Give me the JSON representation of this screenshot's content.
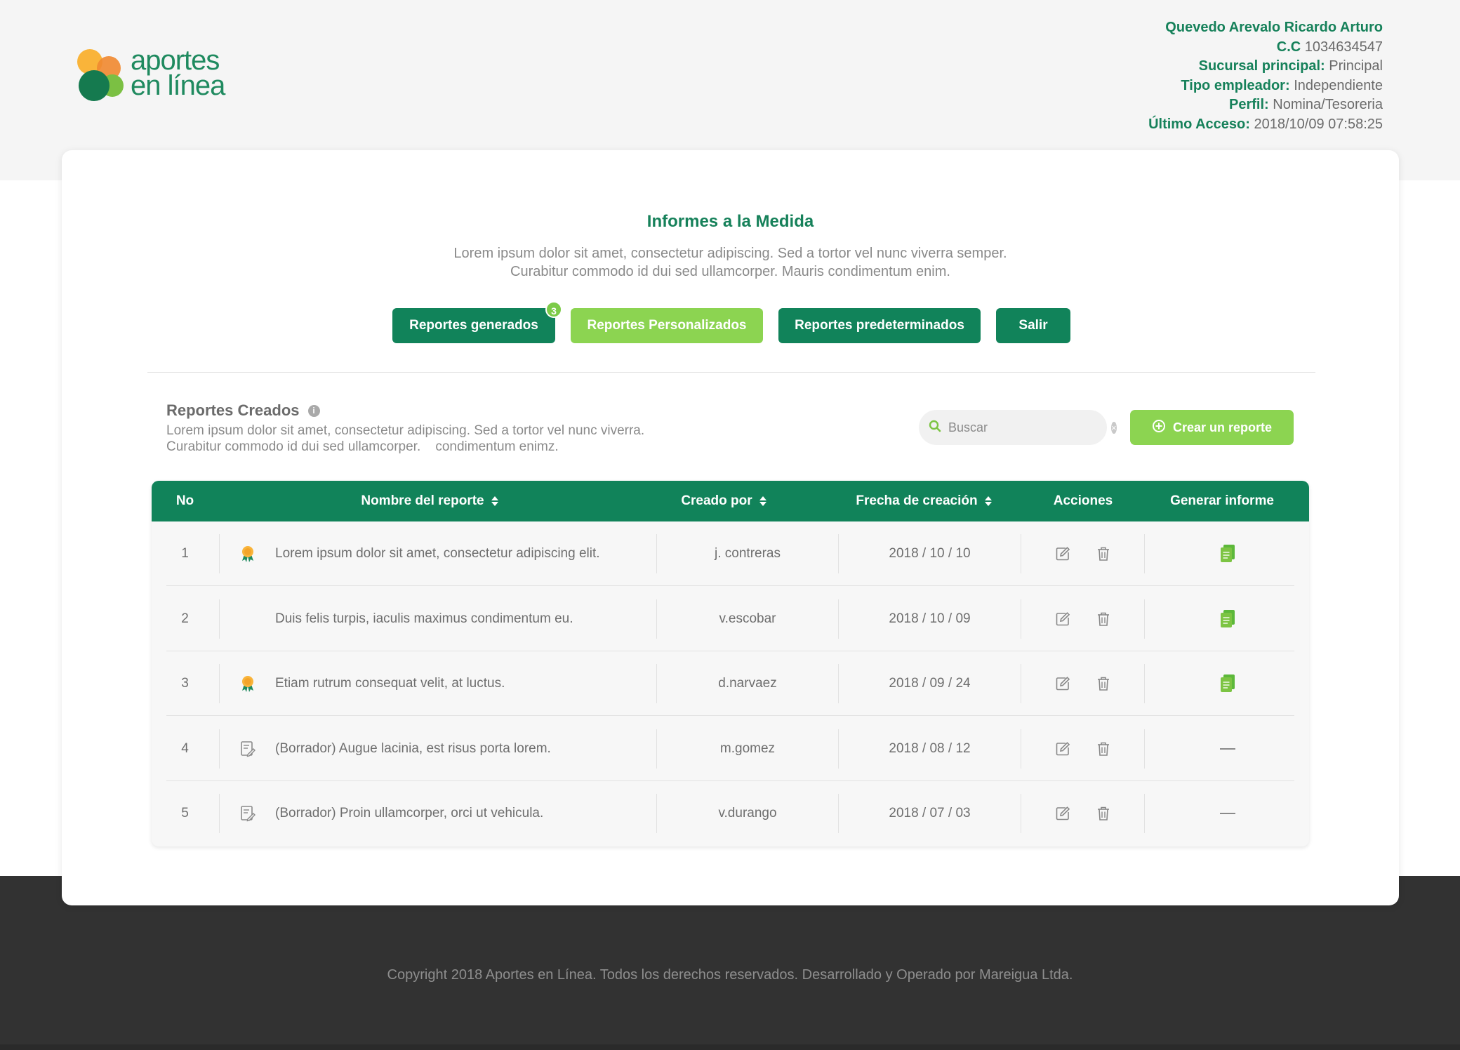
{
  "app": {
    "logo_line1": "aportes",
    "logo_line2": "en línea"
  },
  "user": {
    "name": "Quevedo Arevalo Ricardo Arturo",
    "cc_label": "C.C",
    "cc_value": "1034634547",
    "branch_label": "Sucursal principal:",
    "branch_value": "Principal",
    "employer_label": "Tipo empleador:",
    "employer_value": "Independiente",
    "profile_label": "Perfil:",
    "profile_value": "Nomina/Tesoreria",
    "last_access_label": "Último Acceso:",
    "last_access_value": "2018/10/09 07:58:25"
  },
  "page": {
    "title": "Informes a la Medida",
    "desc_line1": "Lorem ipsum dolor sit amet, consectetur adipiscing. Sed a tortor vel nunc viverra semper.",
    "desc_line2": "Curabitur commodo id dui sed ullamcorper. Mauris condimentum enim."
  },
  "nav": {
    "generated": "Reportes generados",
    "generated_badge": "3",
    "custom": "Reportes Personalizados",
    "default": "Reportes predeterminados",
    "exit": "Salir"
  },
  "section": {
    "title": "Reportes Creados",
    "desc_line1": "Lorem ipsum dolor sit amet, consectetur adipiscing. Sed a tortor vel nunc viverra.",
    "desc_line2": "Curabitur commodo id dui sed ullamcorper.    condimentum enimz.",
    "search_placeholder": "Buscar",
    "create_label": "Crear un reporte"
  },
  "table": {
    "headers": {
      "no": "No",
      "name": "Nombre del reporte",
      "created_by": "Creado por",
      "date": "Frecha de creación",
      "actions": "Acciones",
      "generate": "Generar informe"
    },
    "rows": [
      {
        "no": "1",
        "icon": "award-icon",
        "name": "Lorem ipsum dolor sit amet, consectetur adipiscing elit.",
        "created_by": "j. contreras",
        "date": "2018 / 10 / 10",
        "generate": "document-icon"
      },
      {
        "no": "2",
        "icon": "",
        "name": "Duis felis turpis, iaculis maximus condimentum eu.",
        "created_by": "v.escobar",
        "date": "2018 / 10 / 09",
        "generate": "document-icon"
      },
      {
        "no": "3",
        "icon": "award-icon",
        "name": "Etiam rutrum consequat velit, at luctus.",
        "created_by": "d.narvaez",
        "date": "2018 / 09 / 24",
        "generate": "document-icon"
      },
      {
        "no": "4",
        "icon": "draft-icon",
        "name": "(Borrador) Augue lacinia, est risus porta lorem.",
        "created_by": "m.gomez",
        "date": "2018 / 08 / 12",
        "generate": "dash"
      },
      {
        "no": "5",
        "icon": "draft-icon",
        "name": "(Borrador) Proin ullamcorper, orci ut vehicula.",
        "created_by": "v.durango",
        "date": "2018 / 07 / 03",
        "generate": "dash"
      }
    ]
  },
  "footer": {
    "text": "Copyright 2018 Aportes en Línea. Todos los derechos reservados. Desarrollado y Operado por Mareigua Ltda."
  },
  "colors": {
    "primary": "#11835a",
    "accent": "#8cd451",
    "footer": "#323232",
    "logo_orange": "#f08a32",
    "logo_yellow": "#f9b43a"
  }
}
